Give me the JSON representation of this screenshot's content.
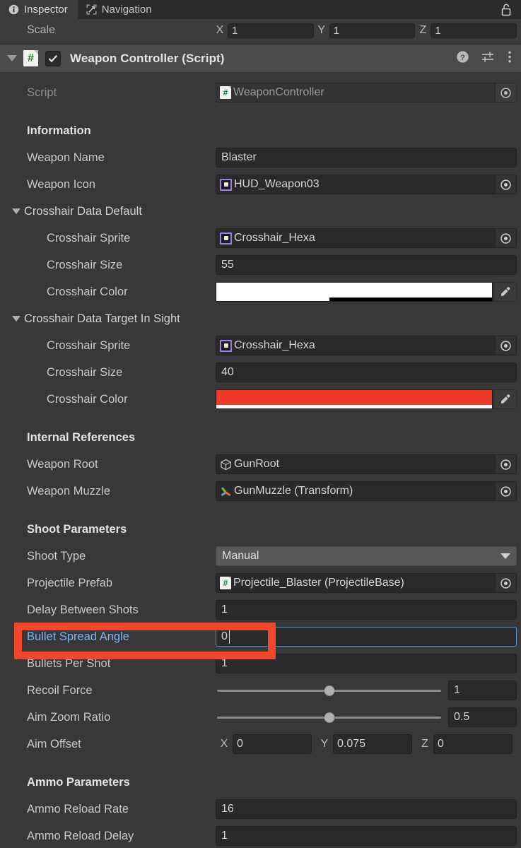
{
  "tabs": [
    {
      "label": "Inspector",
      "icon": "info-icon",
      "active": true
    },
    {
      "label": "Navigation",
      "icon": "navigation-icon",
      "active": false
    }
  ],
  "lock_icon": "lock-open-icon",
  "transform": {
    "scale_label": "Scale",
    "axes": [
      {
        "letter": "X",
        "value": "1"
      },
      {
        "letter": "Y",
        "value": "1"
      },
      {
        "letter": "Z",
        "value": "1"
      }
    ]
  },
  "component": {
    "title": "Weapon Controller (Script)",
    "enabled": true,
    "script_icon": "csharp-script-icon",
    "help_icon": "help-icon",
    "preset_icon": "preset-sliders-icon",
    "menu_icon": "kebab-menu-icon",
    "script_field": {
      "label": "Script",
      "value": "WeaponController"
    }
  },
  "sections": {
    "information": {
      "header": "Information",
      "weapon_name": {
        "label": "Weapon Name",
        "value": "Blaster"
      },
      "weapon_icon": {
        "label": "Weapon Icon",
        "value": "HUD_Weapon03"
      }
    },
    "crosshair_default": {
      "foldout": "Crosshair Data Default",
      "sprite": {
        "label": "Crosshair Sprite",
        "value": "Crosshair_Hexa"
      },
      "size": {
        "label": "Crosshair Size",
        "value": "55"
      },
      "color": {
        "label": "Crosshair Color",
        "hex": "#FFFFFF",
        "alpha_percent": 41
      }
    },
    "crosshair_target": {
      "foldout": "Crosshair Data Target In Sight",
      "sprite": {
        "label": "Crosshair Sprite",
        "value": "Crosshair_Hexa"
      },
      "size": {
        "label": "Crosshair Size",
        "value": "40"
      },
      "color": {
        "label": "Crosshair Color",
        "hex": "#EE3A2A",
        "alpha_percent": 100
      }
    },
    "internal_references": {
      "header": "Internal References",
      "weapon_root": {
        "label": "Weapon Root",
        "value": "GunRoot"
      },
      "weapon_muzzle": {
        "label": "Weapon Muzzle",
        "value": "GunMuzzle (Transform)"
      }
    },
    "shoot_parameters": {
      "header": "Shoot Parameters",
      "shoot_type": {
        "label": "Shoot Type",
        "value": "Manual"
      },
      "projectile_prefab": {
        "label": "Projectile Prefab",
        "value": "Projectile_Blaster (ProjectileBase)"
      },
      "delay_between_shots": {
        "label": "Delay Between Shots",
        "value": "1"
      },
      "bullet_spread_angle": {
        "label": "Bullet Spread Angle",
        "value": "0",
        "focused": true
      },
      "bullets_per_shot": {
        "label": "Bullets Per Shot",
        "value": "1"
      },
      "recoil_force": {
        "label": "Recoil Force",
        "value": "1",
        "slider_percent": 50
      },
      "aim_zoom_ratio": {
        "label": "Aim Zoom Ratio",
        "value": "0.5",
        "slider_percent": 50
      },
      "aim_offset": {
        "label": "Aim Offset",
        "axes": [
          {
            "letter": "X",
            "value": "0"
          },
          {
            "letter": "Y",
            "value": "0.075"
          },
          {
            "letter": "Z",
            "value": "0"
          }
        ]
      }
    },
    "ammo_parameters": {
      "header": "Ammo Parameters",
      "ammo_reload_rate": {
        "label": "Ammo Reload Rate",
        "value": "16"
      },
      "ammo_reload_delay": {
        "label": "Ammo Reload Delay",
        "value": "1"
      }
    }
  },
  "annotation": {
    "color": "#f4462a",
    "targets": "bullet-spread-angle-row"
  }
}
